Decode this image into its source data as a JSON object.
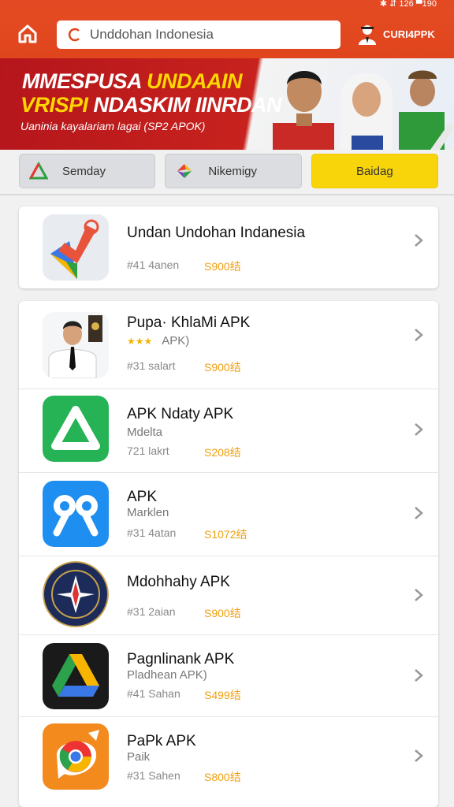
{
  "status": {
    "text": "✱ ⇵ 126 ▀190"
  },
  "header": {
    "search_text": "Unddohan Indonesia",
    "user_label": "CURI4PPK"
  },
  "banner": {
    "line1_a": "MMESPUSA ",
    "line1_b": "UNDAAIN",
    "line2_a": "VRISPI ",
    "line2_b": "NDASKIM IINRDAN",
    "line3": "Uaninia kayalariam lagai (SP2 APOK)"
  },
  "tabs": [
    {
      "label": "Semday"
    },
    {
      "label": "Nikemigy"
    },
    {
      "label": "Baidag"
    }
  ],
  "featured": {
    "name": "Undan Undohan Indanesia",
    "meta": "#41 4anen",
    "price": "S900结"
  },
  "apps": [
    {
      "name": "Pupa· KhlaMi APK",
      "sub": "APK)",
      "stars": "★★★",
      "meta": "#31 salart",
      "price": "S900结"
    },
    {
      "name": "APK Ndaty APK",
      "sub": "Mdelta",
      "meta": "721 lakrt",
      "price": "S208结"
    },
    {
      "name": "APK",
      "sub": "Marklen",
      "meta": "#31 4atan",
      "price": "S1072结"
    },
    {
      "name": "Mdohhahy APK",
      "sub": "",
      "meta": "#31 2aian",
      "price": "S900结"
    },
    {
      "name": "Pagnlinank APK",
      "sub": "Pladhean APK)",
      "meta": "#41 Sahan",
      "price": "S499结"
    },
    {
      "name": "PaPk APK",
      "sub": "Paik",
      "meta": "#31 Sahen",
      "price": "S800结"
    }
  ],
  "colors": {
    "header": "#e34a24",
    "accent": "#f8d40a",
    "price": "#f0a010"
  }
}
